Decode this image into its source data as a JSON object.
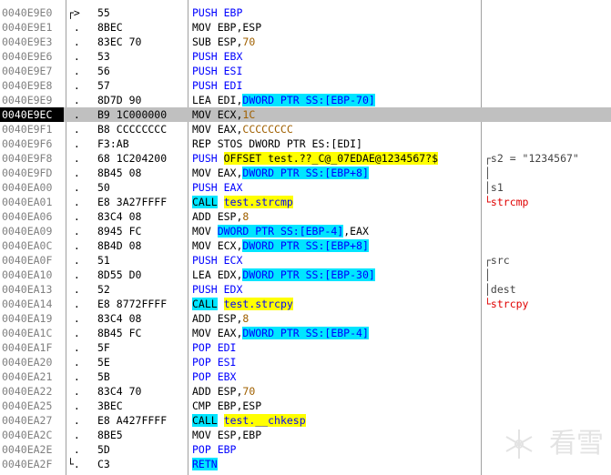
{
  "rows": [
    {
      "addr": "0040E9E0",
      "br": "┌>",
      "hex": "55",
      "ins": "PUSH EBP",
      "kind": "push"
    },
    {
      "addr": "0040E9E1",
      "br": " .",
      "hex": "8BEC",
      "ins": "MOV EBP,ESP",
      "kind": "plain"
    },
    {
      "addr": "0040E9E3",
      "br": " .",
      "hex": "83EC 70",
      "ins": "SUB ESP,",
      "imm": "70",
      "kind": "imm"
    },
    {
      "addr": "0040E9E6",
      "br": " .",
      "hex": "53",
      "ins": "PUSH EBX",
      "kind": "push"
    },
    {
      "addr": "0040E9E7",
      "br": " .",
      "hex": "56",
      "ins": "PUSH ESI",
      "kind": "push"
    },
    {
      "addr": "0040E9E8",
      "br": " .",
      "hex": "57",
      "ins": "PUSH EDI",
      "kind": "push"
    },
    {
      "addr": "0040E9E9",
      "br": " .",
      "hex": "8D7D 90",
      "ins": "LEA EDI,",
      "mem": "DWORD PTR SS:[EBP-70]",
      "kind": "mem"
    },
    {
      "addr": "0040E9EC",
      "br": " .",
      "hex": "B9 1C000000",
      "ins": "MOV ECX,",
      "imm": "1C",
      "kind": "imm"
    },
    {
      "addr": "0040E9F1",
      "br": " .",
      "hex": "B8 CCCCCCCC",
      "ins": "MOV EAX,",
      "imm": "CCCCCCCC",
      "kind": "imm"
    },
    {
      "addr": "0040E9F6",
      "br": " .",
      "hex": "F3:AB",
      "ins": "REP STOS DWORD PTR ES:[EDI]",
      "kind": "plain"
    },
    {
      "addr": "0040E9F8",
      "br": " .",
      "hex": "68 1C204200",
      "ins": "PUSH ",
      "offs": "OFFSET test.??_C@_07EDAE@1234567?$",
      "kind": "offset"
    },
    {
      "addr": "0040E9FD",
      "br": " .",
      "hex": "8B45 08",
      "ins": "MOV EAX,",
      "mem": "DWORD PTR SS:[EBP+8]",
      "kind": "mem"
    },
    {
      "addr": "0040EA00",
      "br": " .",
      "hex": "50",
      "ins": "PUSH EAX",
      "kind": "push"
    },
    {
      "addr": "0040EA01",
      "br": " .",
      "hex": "E8 3A27FFFF",
      "ins": "CALL",
      "target": "test.strcmp",
      "kind": "call"
    },
    {
      "addr": "0040EA06",
      "br": " .",
      "hex": "83C4 08",
      "ins": "ADD ESP,",
      "imm": "8",
      "kind": "imm"
    },
    {
      "addr": "0040EA09",
      "br": " .",
      "hex": "8945 FC",
      "ins": "MOV ",
      "mem": "DWORD PTR SS:[EBP-4]",
      "suffix": ",EAX",
      "kind": "memfirst"
    },
    {
      "addr": "0040EA0C",
      "br": " .",
      "hex": "8B4D 08",
      "ins": "MOV ECX,",
      "mem": "DWORD PTR SS:[EBP+8]",
      "kind": "mem"
    },
    {
      "addr": "0040EA0F",
      "br": " .",
      "hex": "51",
      "ins": "PUSH ECX",
      "kind": "push"
    },
    {
      "addr": "0040EA10",
      "br": " .",
      "hex": "8D55 D0",
      "ins": "LEA EDX,",
      "mem": "DWORD PTR SS:[EBP-30]",
      "kind": "mem"
    },
    {
      "addr": "0040EA13",
      "br": " .",
      "hex": "52",
      "ins": "PUSH EDX",
      "kind": "push"
    },
    {
      "addr": "0040EA14",
      "br": " .",
      "hex": "E8 8772FFFF",
      "ins": "CALL",
      "target": "test.strcpy",
      "kind": "call"
    },
    {
      "addr": "0040EA19",
      "br": " .",
      "hex": "83C4 08",
      "ins": "ADD ESP,",
      "imm": "8",
      "kind": "imm"
    },
    {
      "addr": "0040EA1C",
      "br": " .",
      "hex": "8B45 FC",
      "ins": "MOV EAX,",
      "mem": "DWORD PTR SS:[EBP-4]",
      "kind": "mem"
    },
    {
      "addr": "0040EA1F",
      "br": " .",
      "hex": "5F",
      "ins": "POP EDI",
      "kind": "pop"
    },
    {
      "addr": "0040EA20",
      "br": " .",
      "hex": "5E",
      "ins": "POP ESI",
      "kind": "pop"
    },
    {
      "addr": "0040EA21",
      "br": " .",
      "hex": "5B",
      "ins": "POP EBX",
      "kind": "pop"
    },
    {
      "addr": "0040EA22",
      "br": " .",
      "hex": "83C4 70",
      "ins": "ADD ESP,",
      "imm": "70",
      "kind": "imm"
    },
    {
      "addr": "0040EA25",
      "br": " .",
      "hex": "3BEC",
      "ins": "CMP EBP,ESP",
      "kind": "plain"
    },
    {
      "addr": "0040EA27",
      "br": " .",
      "hex": "E8 A427FFFF",
      "ins": "CALL",
      "target": "test.__chkesp",
      "kind": "call"
    },
    {
      "addr": "0040EA2C",
      "br": " .",
      "hex": "8BE5",
      "ins": "MOV ESP,EBP",
      "kind": "plain"
    },
    {
      "addr": "0040EA2E",
      "br": " .",
      "hex": "5D",
      "ins": "POP EBP",
      "kind": "pop"
    },
    {
      "addr": "0040EA2F",
      "br": "└.",
      "hex": "C3",
      "ins": "RETN",
      "kind": "retn"
    }
  ],
  "selected_addr": "0040E9EC",
  "comments": [
    {
      "row": 10,
      "text": "┌s2 = \"1234567\"",
      "style": "gray"
    },
    {
      "row": 11,
      "text": "│",
      "style": "gray"
    },
    {
      "row": 12,
      "text": "│s1",
      "style": "gray"
    },
    {
      "row": 13,
      "text": "└strcmp",
      "style": "red"
    },
    {
      "row": 17,
      "text": "┌src",
      "style": "gray"
    },
    {
      "row": 18,
      "text": "│",
      "style": "gray"
    },
    {
      "row": 19,
      "text": "│dest",
      "style": "gray"
    },
    {
      "row": 20,
      "text": "└strcpy",
      "style": "red"
    }
  ],
  "watermark_text": "看雪",
  "colors": {
    "highlight_cyan": "#00e5ff",
    "highlight_yellow": "#ffff00",
    "selected_row": "#c0c0c0",
    "address": "#808080"
  }
}
